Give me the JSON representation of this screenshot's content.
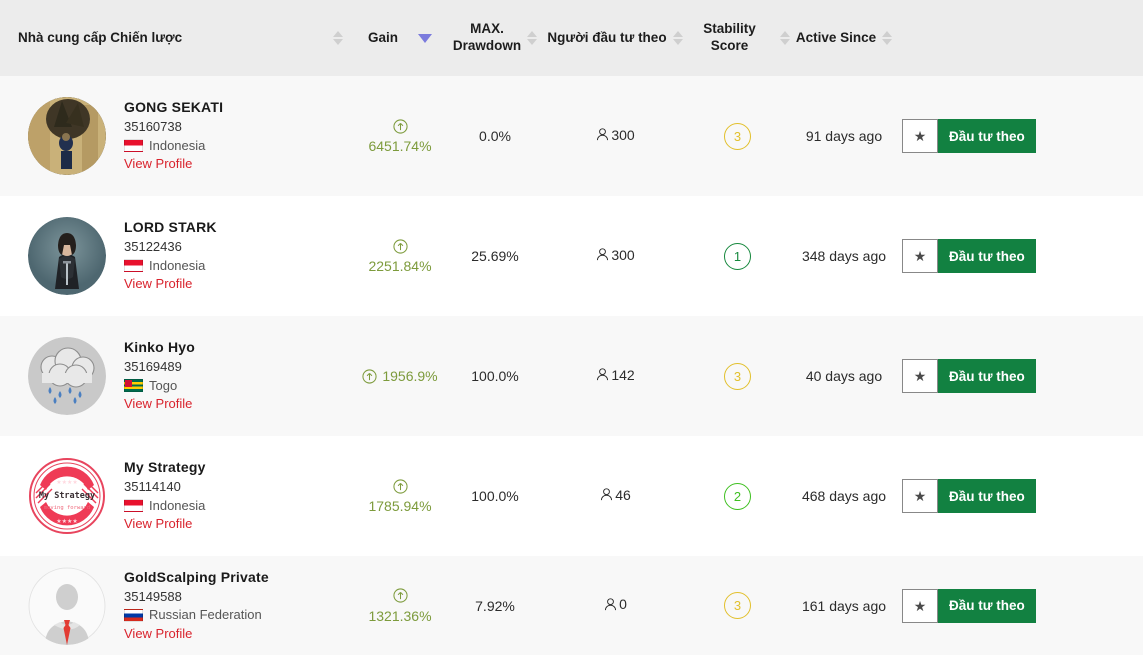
{
  "table": {
    "columns": [
      {
        "label": "Nhà cung cấp Chiến lược",
        "sortable": true,
        "sort_state": "none",
        "align": "left"
      },
      {
        "label": "Gain",
        "sortable": true,
        "sort_state": "desc",
        "align": "center"
      },
      {
        "label": "MAX.\nDrawdown",
        "sortable": true,
        "sort_state": "none",
        "align": "center"
      },
      {
        "label": "Người đầu tư theo",
        "sortable": true,
        "sort_state": "none",
        "align": "center"
      },
      {
        "label": "Stability Score",
        "sortable": true,
        "sort_state": "none",
        "align": "center"
      },
      {
        "label": "Active Since",
        "sortable": true,
        "sort_state": "none",
        "align": "center"
      },
      {
        "label": "",
        "sortable": false,
        "align": "center"
      }
    ],
    "view_profile_label": "View Profile",
    "follow_button_label": "Đầu tư theo",
    "favorite_icon": "star-icon",
    "investors_icon": "user-icon",
    "gain_direction_icon": "arrow-up-circle-icon",
    "rows": [
      {
        "name": "GONG SEKATI",
        "id": "35160738",
        "country": "Indonesia",
        "country_code": "id",
        "avatar": "photo-sepia-tree",
        "gain": "6451.74%",
        "gain_layout": "stacked",
        "drawdown": "0.0%",
        "investors": "300",
        "stability_score": "3",
        "stability_color": "#e2c02c",
        "active_since": "91 days ago"
      },
      {
        "name": "LORD STARK",
        "id": "35122436",
        "country": "Indonesia",
        "country_code": "id",
        "avatar": "character-jon-snow",
        "gain": "2251.84%",
        "gain_layout": "stacked",
        "drawdown": "25.69%",
        "investors": "300",
        "stability_score": "1",
        "stability_color": "#16883d",
        "active_since": "348 days ago"
      },
      {
        "name": "Kinko Hyo",
        "id": "35169489",
        "country": "Togo",
        "country_code": "tg",
        "avatar": "rain-cloud",
        "gain": "1956.9%",
        "gain_layout": "inline",
        "drawdown": "100.0%",
        "investors": "142",
        "stability_score": "3",
        "stability_color": "#e2c02c",
        "active_since": "40 days ago"
      },
      {
        "name": "My Strategy",
        "id": "35114140",
        "country": "Indonesia",
        "country_code": "id",
        "avatar": "badge-my-strategy",
        "avatar_text": "My Strategy",
        "avatar_subtext": "moving forward",
        "gain": "1785.94%",
        "gain_layout": "stacked",
        "drawdown": "100.0%",
        "investors": "46",
        "stability_score": "2",
        "stability_color": "#3fc021",
        "active_since": "468 days ago"
      },
      {
        "name": "GoldScalping Private",
        "id": "35149588",
        "country": "Russian Federation",
        "country_code": "ru",
        "avatar": "default-person-silhouette",
        "gain": "1321.36%",
        "gain_layout": "stacked",
        "drawdown": "7.92%",
        "investors": "0",
        "stability_score": "3",
        "stability_color": "#e2c02c",
        "active_since": "161 days ago"
      }
    ]
  },
  "theme": {
    "header_bg": "#ececec",
    "row_alt_bg": "#f8f8f8",
    "gain_color": "#7d9b3c",
    "link_color": "#d9232d",
    "follow_button_bg": "#128141",
    "sort_active_color": "#7b7bdd"
  }
}
